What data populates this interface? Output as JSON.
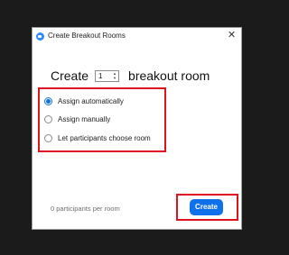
{
  "window": {
    "title": "Create Breakout Rooms",
    "app_icon": "zoom-logo-icon",
    "close_glyph": "✕"
  },
  "heading": {
    "prefix": "Create",
    "room_count": "1",
    "suffix": "breakout room"
  },
  "options": [
    {
      "label": "Assign automatically",
      "selected": true
    },
    {
      "label": "Assign manually",
      "selected": false
    },
    {
      "label": "Let participants choose room",
      "selected": false
    }
  ],
  "footer": {
    "participants_text": "0 participants per room",
    "create_label": "Create"
  },
  "colors": {
    "accent_blue": "#0e71eb",
    "highlight_red": "#e0121e",
    "background": "#1b1b1b"
  }
}
